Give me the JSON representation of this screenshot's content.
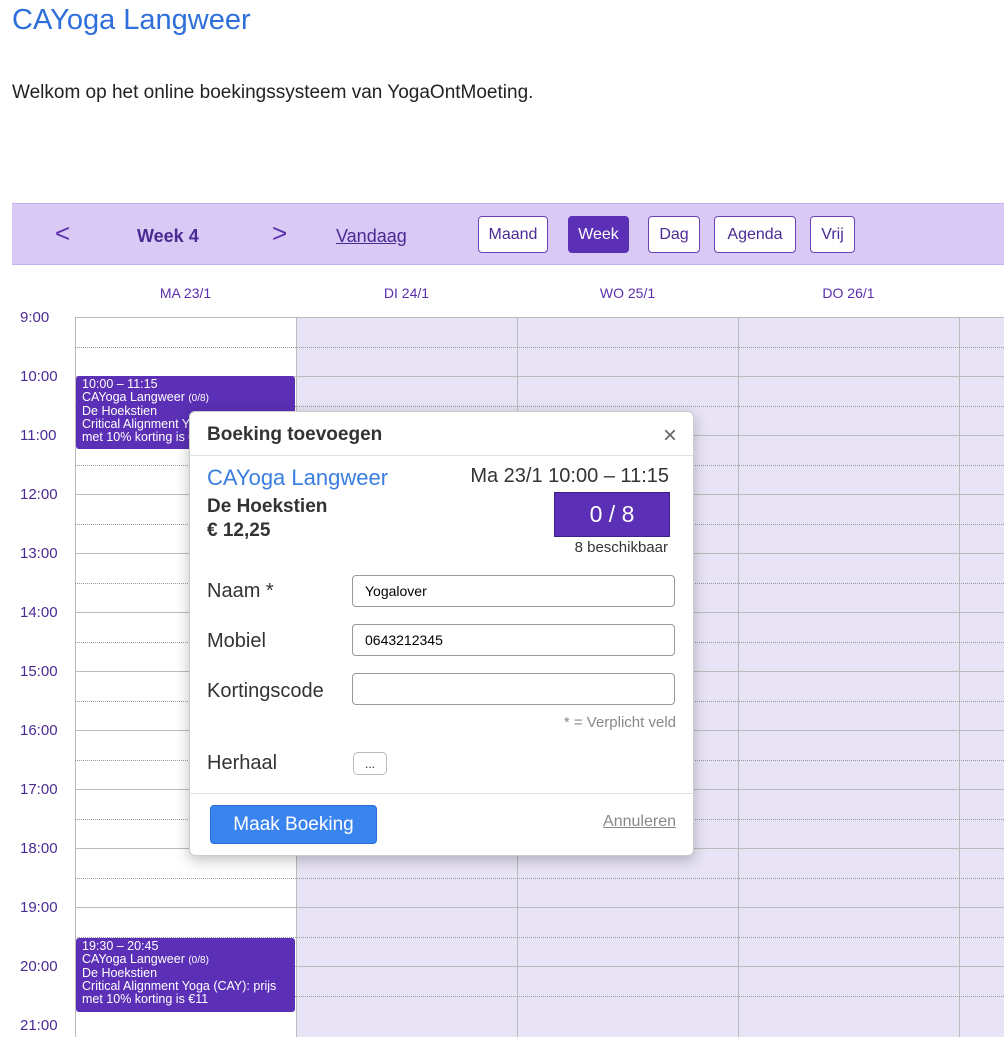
{
  "page": {
    "title": "CAYoga Langweer",
    "welcome": "Welkom op het online boekingssysteem van YogaOntMoeting."
  },
  "toolbar": {
    "prev_glyph": "<",
    "next_glyph": ">",
    "week_label": "Week 4",
    "today_label": "Vandaag",
    "views": [
      "Maand",
      "Week",
      "Dag",
      "Agenda",
      "Vrij"
    ],
    "active_view": "Week"
  },
  "calendar": {
    "days": [
      "MA 23/1",
      "DI 24/1",
      "WO 25/1",
      "DO 26/1"
    ],
    "hours": [
      "9:00",
      "10:00",
      "11:00",
      "12:00",
      "13:00",
      "14:00",
      "15:00",
      "16:00",
      "17:00",
      "18:00",
      "19:00",
      "20:00",
      "21:00"
    ],
    "events": [
      {
        "time": "10:00 – 11:15",
        "name": "CAYoga Langweer",
        "capacity": "(0/8)",
        "location": "De Hoekstien",
        "description": "Critical Alignment Yoga (CAY): prijs met 10% korting is €11"
      },
      {
        "time": "19:30 – 20:45",
        "name": "CAYoga Langweer",
        "capacity": "(0/8)",
        "location": "De Hoekstien",
        "description": "Critical Alignment Yoga (CAY): prijs met 10% korting is €11"
      }
    ]
  },
  "dialog": {
    "title": "Boeking toevoegen",
    "close_glyph": "×",
    "class_name": "CAYoga Langweer",
    "datetime": "Ma 23/1  10:00 – 11:15",
    "location": "De Hoekstien",
    "price": "€ 12,25",
    "capacity": "0 / 8",
    "available": "8 beschikbaar",
    "fields": {
      "name_label": "Naam *",
      "name_value": "Yogalover",
      "mobile_label": "Mobiel",
      "mobile_value": "0643212345",
      "discount_label": "Kortingscode",
      "discount_value": ""
    },
    "required_note": "* = Verplicht veld",
    "repeat_label": "Herhaal",
    "repeat_button": "...",
    "submit_label": "Maak Boeking",
    "cancel_label": "Annuleren"
  },
  "colors": {
    "accent": "#5b30b6",
    "toolbar_bg": "#d9c9f5",
    "busy_bg": "#e8e4f6",
    "link_blue": "#2f6fdb",
    "button_blue": "#3a84f0"
  }
}
